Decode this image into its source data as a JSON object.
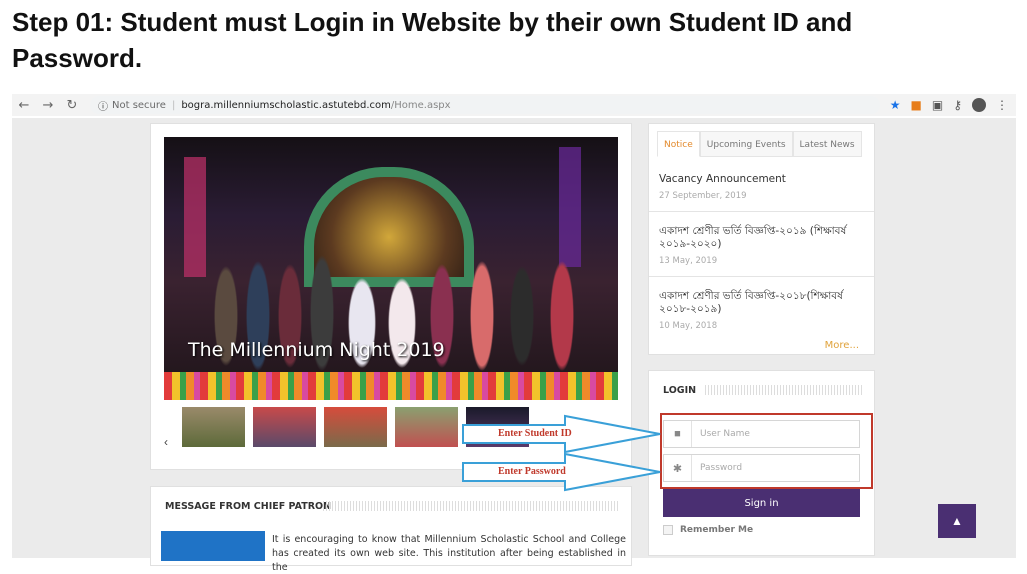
{
  "step_title": "Step 01: Student must Login in Website by their own Student ID and Password.",
  "browser": {
    "security": "Not secure",
    "host": "bogra.millenniumscholastic.astutebd.com",
    "path": "/Home.aspx",
    "icons": [
      "back-arrow-icon",
      "forward-arrow-icon",
      "reload-icon",
      "info-icon",
      "star-icon",
      "key-icon",
      "menu-dots-icon"
    ]
  },
  "slider": {
    "caption": "The Millennium Night 2019",
    "prev_glyph": "‹"
  },
  "message": {
    "title": "MESSAGE FROM CHIEF PATRON",
    "text": "It is encouraging to know that Millennium Scholastic School and College has created its own web site. This institution after being established in the"
  },
  "notice": {
    "tabs": [
      "Notice",
      "Upcoming Events",
      "Latest News"
    ],
    "items": [
      {
        "title": "Vacancy Announcement",
        "date": "27 September, 2019"
      },
      {
        "title": "একাদশ শ্রেণীর ভর্তি বিজ্ঞপ্তি-২০১৯ (শিক্ষাবর্ষ ২০১৯-২০২০)",
        "date": "13 May, 2019"
      },
      {
        "title": "একাদশ শ্রেণীর ভর্তি বিজ্ঞপ্তি-২০১৮(শিক্ষাবর্ষ ২০১৮-২০১৯)",
        "date": "10 May, 2018"
      }
    ],
    "more": "More..."
  },
  "login": {
    "title": "LOGIN",
    "username_placeholder": "User Name",
    "password_placeholder": "Password",
    "signin": "Sign in",
    "remember": "Remember Me"
  },
  "annotations": {
    "student_id": "Enter Student ID",
    "password": "Enter Password"
  },
  "colors": {
    "accent": "#4a2f72",
    "highlight": "#c0392b",
    "arrow": "#3aa0d8",
    "tab_active": "#e38a2c"
  }
}
